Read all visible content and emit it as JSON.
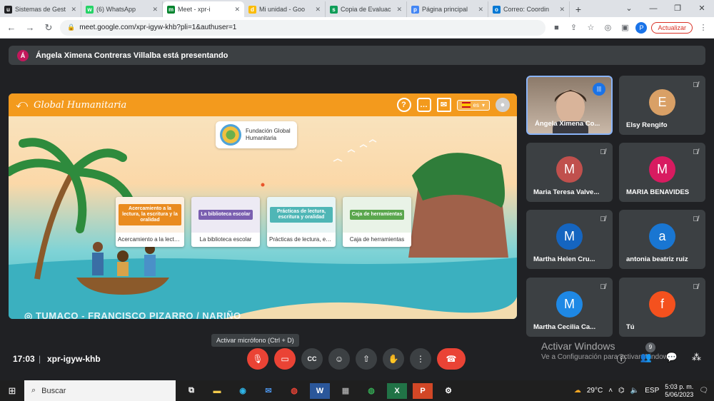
{
  "tabs": [
    {
      "title": "Sistemas de Gest",
      "color": "#202124",
      "glyph": "u"
    },
    {
      "title": "(6) WhatsApp",
      "color": "#25d366",
      "glyph": "w"
    },
    {
      "title": "Meet - xpr-i",
      "color": "#00832d",
      "glyph": "m",
      "active": true
    },
    {
      "title": "Mi unidad - Goo",
      "color": "#fbbc04",
      "glyph": "d"
    },
    {
      "title": "Copia de Evaluac",
      "color": "#0f9d58",
      "glyph": "s"
    },
    {
      "title": "Página principal",
      "color": "#4285f4",
      "glyph": "p"
    },
    {
      "title": "Correo: Coordin",
      "color": "#0078d4",
      "glyph": "o"
    }
  ],
  "browser": {
    "url": "meet.google.com/xpr-igyw-khb?pli=1&authuser=1",
    "profile_initial": "P",
    "update_label": "Actualizar"
  },
  "banner": {
    "avatar_initial": "Á",
    "text": "Ángela Ximena Contreras Villalba está presentando"
  },
  "presentation": {
    "title": "Global Humanitaria",
    "lang": "es",
    "foundation_line1": "Fundación Global",
    "foundation_line2": "Humanitaria",
    "location": "TUMACO - FRANCISCO PIZARRO / NARIÑO",
    "cards": [
      {
        "image_text": "Acercamiento a la lectura, la escritura y la oralidad",
        "caption": "Acercamiento a la lectur...",
        "color": "#e98b1f"
      },
      {
        "image_text": "La biblioteca escolar",
        "caption": "La biblioteca escolar",
        "color": "#7a5fb0"
      },
      {
        "image_text": "Prácticas de lectura, escritura y oralidad",
        "caption": "Prácticas de lectura, escr...",
        "color": "#4fb6b6"
      },
      {
        "image_text": "Caja de herramientas",
        "caption": "Caja de herramientas",
        "color": "#5aa64d"
      }
    ]
  },
  "participants": [
    {
      "name": "Ángela Ximena Co...",
      "initial": "",
      "color": "#8c7a6a",
      "speaking": true
    },
    {
      "name": "Elsy Rengifo",
      "initial": "E",
      "color": "#d9a066"
    },
    {
      "name": "Maria Teresa Valve...",
      "initial": "M",
      "color": "#c0504d"
    },
    {
      "name": "MARIA BENAVIDES",
      "initial": "M",
      "color": "#d81b60"
    },
    {
      "name": "Martha Helen Cru...",
      "initial": "M",
      "color": "#1565c0"
    },
    {
      "name": "antonia beatriz ruiz",
      "initial": "a",
      "color": "#1976d2"
    },
    {
      "name": "Martha Cecilia Ca...",
      "initial": "M",
      "color": "#1e88e5"
    },
    {
      "name": "Tú",
      "initial": "f",
      "color": "#f4511e"
    }
  ],
  "bottombar": {
    "tooltip": "Activar micrófono (Ctrl + D)",
    "time": "17:03",
    "meeting_code": "xpr-igyw-khb",
    "participant_count": "9",
    "activate_title": "Activar Windows",
    "activate_sub": "Ve a Configuración para activar Windows."
  },
  "taskbar": {
    "search_placeholder": "Buscar",
    "weather": "29°C",
    "lang": "ESP",
    "clock_time": "5:03 p. m.",
    "clock_date": "5/06/2023"
  }
}
